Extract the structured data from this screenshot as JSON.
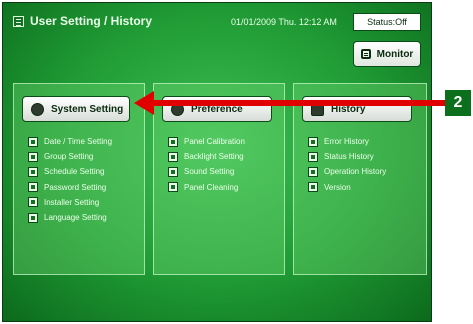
{
  "header": {
    "title": "User Setting / History",
    "datetime": "01/01/2009 Thu. 12:12 AM"
  },
  "status": {
    "label": "Status:Off"
  },
  "monitor": {
    "label": "Monitor"
  },
  "panels": [
    {
      "button_label": "System Setting",
      "items": [
        "Date / Time Setting",
        "Group Setting",
        "Schedule Setting",
        "Password Setting",
        "Installer Setting",
        "Language Setting"
      ]
    },
    {
      "button_label": "Preference",
      "items": [
        "Panel Calibration",
        "Backlight Setting",
        "Sound Setting",
        "Panel Cleaning"
      ]
    },
    {
      "button_label": "History",
      "items": [
        "Error History",
        "Status History",
        "Operation History",
        "Version"
      ]
    }
  ],
  "callout": {
    "number": "2"
  },
  "colors": {
    "screen_green": "#1f9a34",
    "arrow_red": "#e00000",
    "badge_green": "#0b6f1b"
  }
}
